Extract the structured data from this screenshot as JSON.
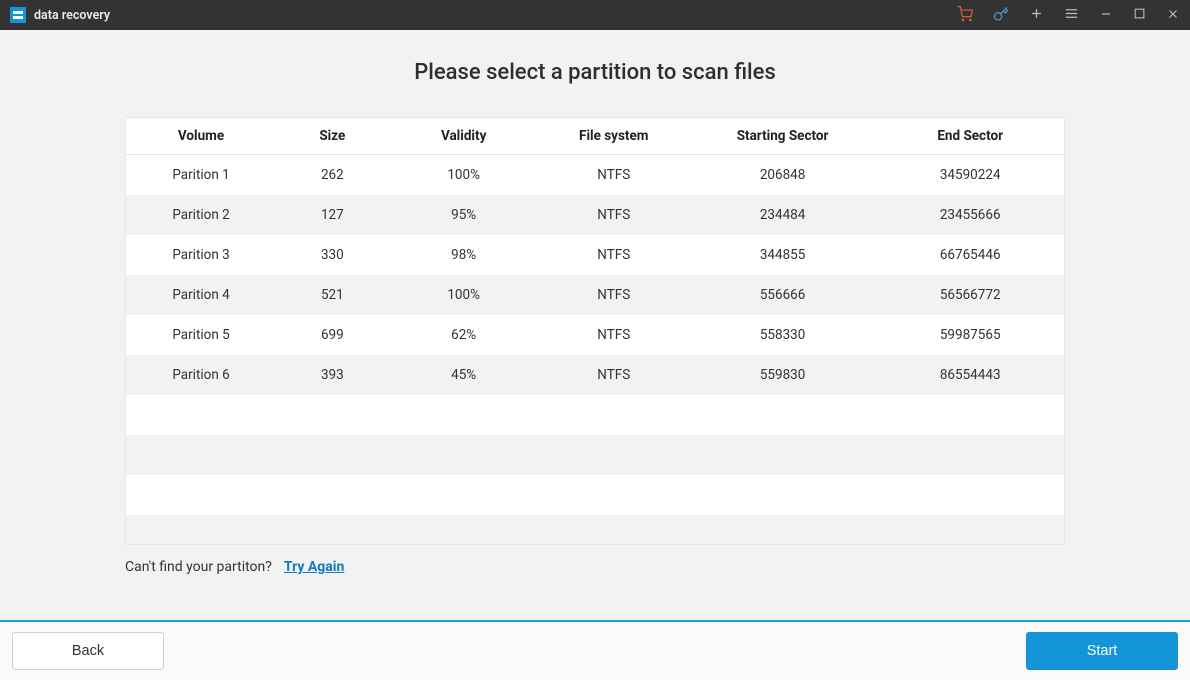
{
  "app": {
    "title": "data recovery"
  },
  "heading": "Please select a partition to scan files",
  "table": {
    "headers": {
      "volume": "Volume",
      "size": "Size",
      "validity": "Validity",
      "filesystem": "File system",
      "start": "Starting Sector",
      "end": "End Sector"
    },
    "rows": [
      {
        "volume": "Parition 1",
        "size": "262",
        "validity": "100%",
        "filesystem": "NTFS",
        "start": "206848",
        "end": "34590224"
      },
      {
        "volume": "Parition 2",
        "size": "127",
        "validity": "95%",
        "filesystem": "NTFS",
        "start": "234484",
        "end": "23455666"
      },
      {
        "volume": "Parition 3",
        "size": "330",
        "validity": "98%",
        "filesystem": "NTFS",
        "start": "344855",
        "end": "66765446"
      },
      {
        "volume": "Parition 4",
        "size": "521",
        "validity": "100%",
        "filesystem": "NTFS",
        "start": "556666",
        "end": "56566772"
      },
      {
        "volume": "Parition 5",
        "size": "699",
        "validity": "62%",
        "filesystem": "NTFS",
        "start": "558330",
        "end": "59987565"
      },
      {
        "volume": "Parition 6",
        "size": "393",
        "validity": "45%",
        "filesystem": "NTFS",
        "start": "559830",
        "end": "86554443"
      }
    ]
  },
  "below": {
    "hint": "Can't find your partiton?",
    "try_again": "Try Again"
  },
  "footer": {
    "back": "Back",
    "start": "Start"
  },
  "icons": {
    "cart": "cart-icon",
    "key": "key-icon",
    "plus": "plus-icon",
    "menu": "menu-icon",
    "minimize": "minimize-icon",
    "maximize": "maximize-icon",
    "close": "close-icon"
  }
}
